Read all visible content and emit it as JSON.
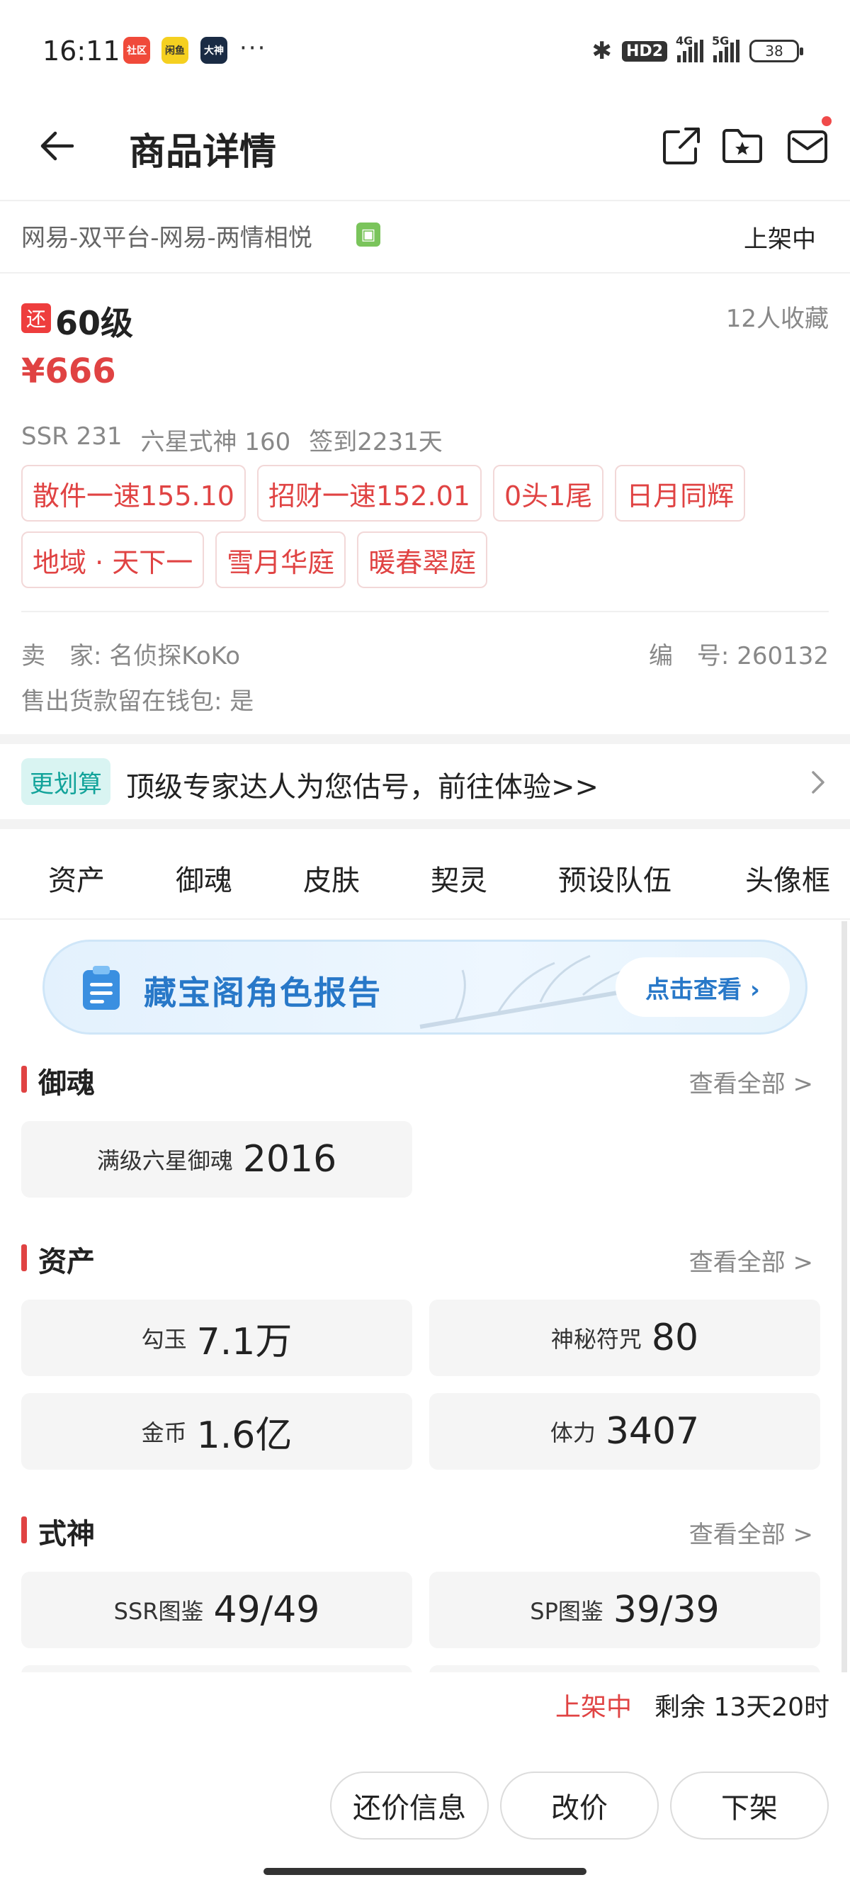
{
  "status_bar": {
    "time": "16:11",
    "apps": [
      "社区",
      "闲鱼",
      "大神"
    ],
    "more": "···",
    "hd": "HD2",
    "net1": "4G",
    "net2": "5G",
    "battery": "38"
  },
  "header": {
    "title": "商品详情",
    "icons": [
      "back-arrow-icon",
      "share-icon",
      "folder-star-icon",
      "mail-icon"
    ]
  },
  "server": {
    "name": "网易-双平台-网易-两情相悦",
    "status": "上架中"
  },
  "product": {
    "haggle_badge": "还",
    "level": "60级",
    "favorites": "12人收藏",
    "price": "¥666",
    "stats": [
      "SSR 231",
      "六星式神 160",
      "签到2231天"
    ],
    "tags": [
      "散件一速155.10",
      "招财一速152.01",
      "0头1尾",
      "日月同辉",
      "地域 · 天下一",
      "雪月华庭",
      "暖春翠庭"
    ],
    "seller": "卖　家: 名侦探KoKo",
    "serial": "编　号: 260132",
    "wallet": "售出货款留在钱包: 是"
  },
  "promo": {
    "badge": "更划算",
    "text": "顶级专家达人为您估号，前往体验>>"
  },
  "tabs": [
    "资产",
    "御魂",
    "皮肤",
    "契灵",
    "预设队伍",
    "头像框"
  ],
  "report": {
    "title": "藏宝阁角色报告",
    "button": "点击查看 ›"
  },
  "sections": {
    "yuhun": {
      "title": "御魂",
      "see_all": "查看全部 >",
      "items": [
        {
          "label": "满级六星御魂",
          "value": "2016"
        }
      ]
    },
    "assets": {
      "title": "资产",
      "see_all": "查看全部 >",
      "items": [
        {
          "label": "勾玉",
          "value": "7.1万"
        },
        {
          "label": "神秘符咒",
          "value": "80"
        },
        {
          "label": "金币",
          "value": "1.6亿"
        },
        {
          "label": "体力",
          "value": "3407"
        }
      ]
    },
    "shishen": {
      "title": "式神",
      "see_all": "查看全部 >",
      "items": [
        {
          "label": "SSR图鉴",
          "value": "49/49"
        },
        {
          "label": "SP图鉴",
          "value": "39/39"
        }
      ]
    }
  },
  "bottom": {
    "status": "上架中",
    "remaining": "剩余 13天20时",
    "buttons": [
      "还价信息",
      "改价",
      "下架"
    ]
  },
  "colors": {
    "accent_red": "#e04343",
    "report_blue": "#2878c8",
    "promo_teal": "#12a39a"
  }
}
